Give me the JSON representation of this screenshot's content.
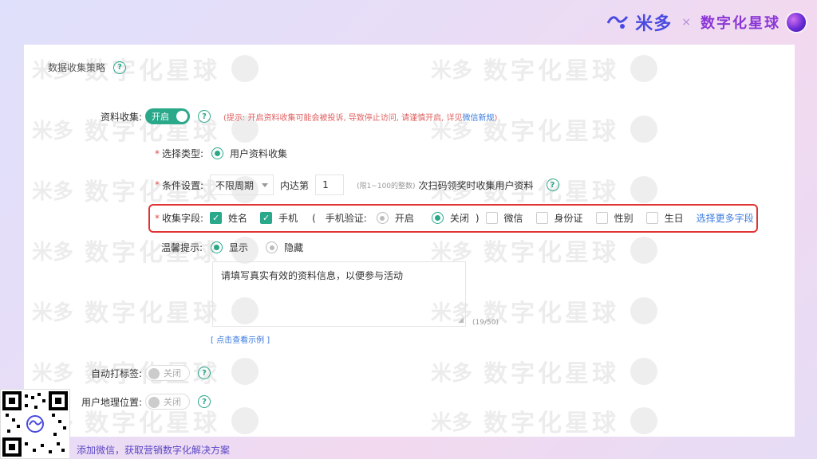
{
  "brand": {
    "logo_text": "米多",
    "separator": "×",
    "title": "数字化星球",
    "sub_logo": "midoo"
  },
  "section": {
    "title": "数据收集策略"
  },
  "resource_collect": {
    "label": "资料收集:",
    "toggle_label": "开启",
    "notice_prefix": "(提示: 开启资料收集可能会被投诉, 导致停止访问, 请谨慎开启, 详见",
    "notice_link": "微信新规",
    "notice_suffix": ")"
  },
  "select_type": {
    "label": "选择类型:",
    "option": "用户资料收集"
  },
  "condition": {
    "label": "条件设置:",
    "period_value": "不限周期",
    "within": "内达第",
    "times_value": "1",
    "hint": "(限1~100的整数)",
    "suffix": "次扫码领奖时收集用户资料"
  },
  "fields": {
    "label": "收集字段:",
    "name": "姓名",
    "phone": "手机",
    "open_paren": "(",
    "phone_verify": "手机验证:",
    "verify_on": "开启",
    "verify_off": "关闭",
    "close_paren": ")",
    "wechat": "微信",
    "id_card": "身份证",
    "gender": "性别",
    "birthday": "生日",
    "more_link": "选择更多字段"
  },
  "tips": {
    "label": "温馨提示:",
    "show": "显示",
    "hide": "隐藏",
    "textarea_value": "请填写真实有效的资料信息，以便参与活动",
    "counter": "(19/50)",
    "example_link": "[ 点击查看示例 ]"
  },
  "auto_tag": {
    "label": "自动打标签:",
    "toggle_label": "关闭"
  },
  "geo": {
    "label": "用户地理位置:",
    "toggle_label": "关闭"
  },
  "footer": {
    "text": "添加微信，获取营销数字化解决方案"
  },
  "watermark": {
    "logo": "米多",
    "title": "数字化星球",
    "sub": "midoo"
  },
  "colors": {
    "accent": "#2aa88a",
    "highlight": "#e03434",
    "link": "#3b7be0",
    "brand": "#8b37d6"
  }
}
